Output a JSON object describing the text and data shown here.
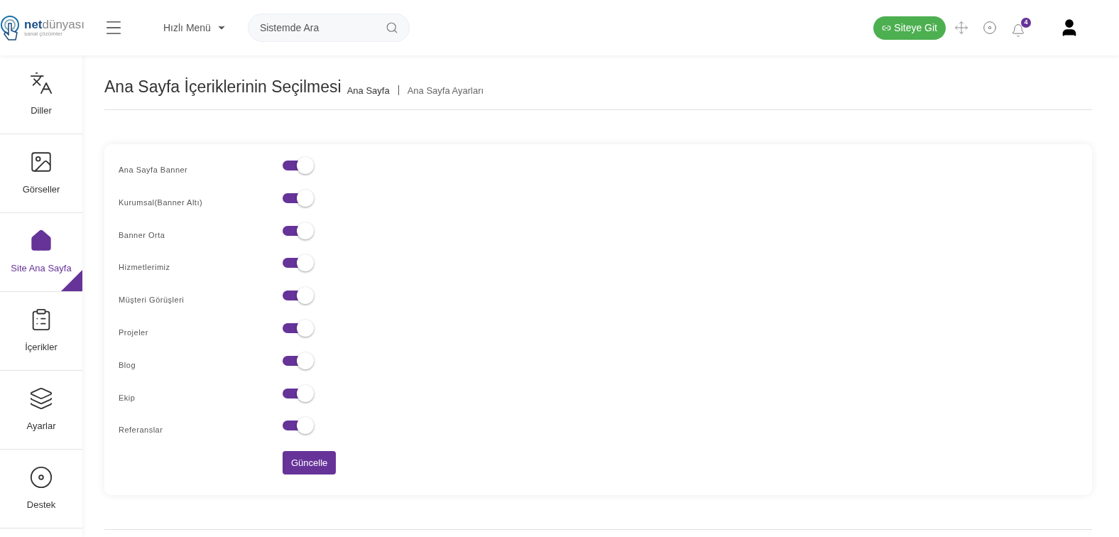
{
  "header": {
    "logo": {
      "word_1": "net",
      "word_2": "dünyası",
      "tagline": "sanal çözümler"
    },
    "quick_menu": "Hızlı Menü",
    "search": {
      "placeholder": "Sistemde Ara"
    },
    "site_button": "Siteye Git",
    "notification_count": "4"
  },
  "sidebar": {
    "items": [
      {
        "label": "Diller",
        "selected": false
      },
      {
        "label": "Görseller",
        "selected": false
      },
      {
        "label": "Site Ana Sayfa",
        "selected": true
      },
      {
        "label": "İçerikler",
        "selected": false
      },
      {
        "label": "Ayarlar",
        "selected": false
      },
      {
        "label": "Destek",
        "selected": false
      }
    ]
  },
  "page": {
    "title": "Ana Sayfa İçeriklerinin Seçilmesi",
    "breadcrumbs": [
      "Ana Sayfa",
      "Ana Sayfa Ayarları"
    ]
  },
  "settings": [
    {
      "label": "Ana Sayfa Banner",
      "on": true
    },
    {
      "label": "Kurumsal(Banner Altı)",
      "on": true
    },
    {
      "label": "Banner Orta",
      "on": true
    },
    {
      "label": "Hizmetlerimiz",
      "on": true
    },
    {
      "label": "Müşteri Görüşleri",
      "on": true
    },
    {
      "label": "Projeler",
      "on": true
    },
    {
      "label": "Blog",
      "on": true
    },
    {
      "label": "Ekip",
      "on": true
    },
    {
      "label": "Referanslar",
      "on": true
    }
  ],
  "submit_button": "Güncelle"
}
